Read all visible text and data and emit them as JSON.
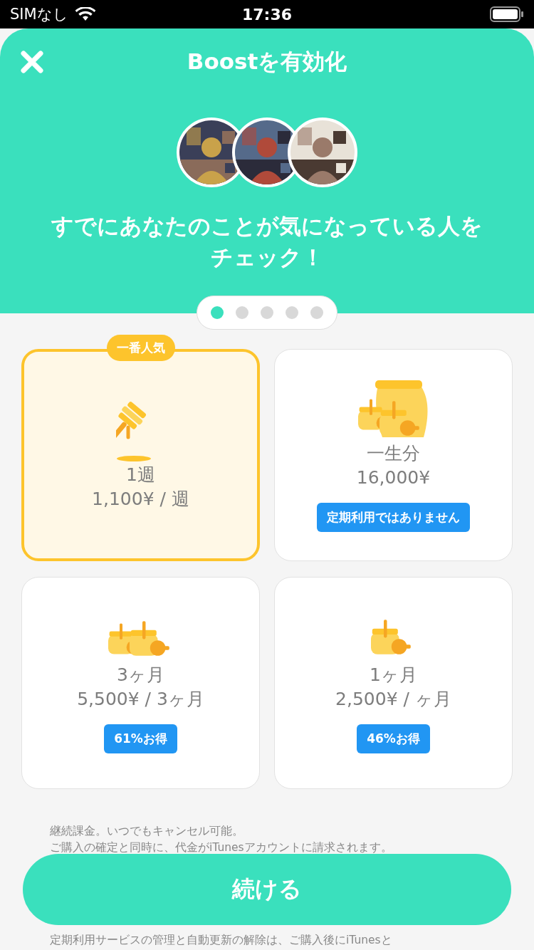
{
  "status_bar": {
    "carrier": "SIMなし",
    "time": "17:36"
  },
  "header": {
    "title": "Boostを有効化",
    "headline": "すでにあなたのことが気になっている人をチェック！"
  },
  "pager": [
    {
      "selected": true
    },
    {
      "selected": false
    },
    {
      "selected": false
    },
    {
      "selected": false
    },
    {
      "selected": false
    }
  ],
  "plans": [
    {
      "kind": "dipper",
      "badge": "一番人気",
      "title": "1週",
      "price": "1,100¥ / 週",
      "selected": true
    },
    {
      "kind": "jars_large",
      "title": "一生分",
      "price": "16,000¥",
      "tag": "定期利用ではありません",
      "selected": false
    },
    {
      "kind": "jars_medium",
      "title": "3ヶ月",
      "price": "5,500¥ / 3ヶ月",
      "tag": "61%お得",
      "selected": false
    },
    {
      "kind": "jar_small",
      "title": "1ヶ月",
      "price": "2,500¥ / ヶ月",
      "tag": "46%お得",
      "selected": false
    }
  ],
  "notes": [
    "継続課金。いつでもキャンセル可能。",
    "ご購入の確定と同時に、代金がiTunesアカウントに請求されます。"
  ],
  "continue_button": "続ける",
  "footer_notes": [
    "定期利用サービスの管理と自動更新の解除は、ご購入後にiTunesと"
  ]
}
